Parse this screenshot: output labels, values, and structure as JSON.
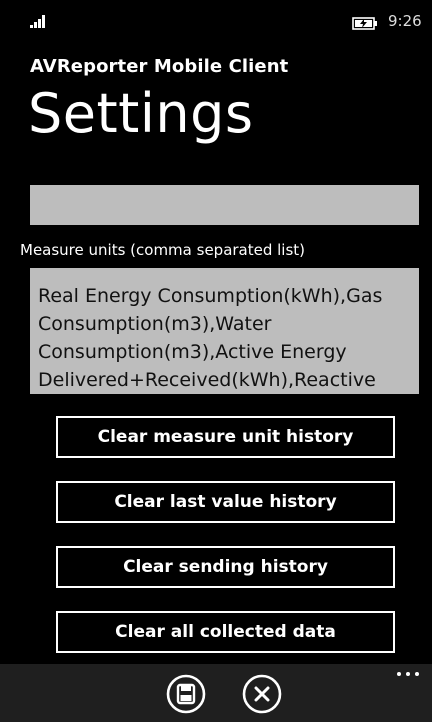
{
  "status_bar": {
    "time": "9:26",
    "signal_icon": "signal-strength-icon",
    "battery_icon": "battery-charging-icon"
  },
  "header": {
    "app_title": "AVReporter Mobile Client",
    "page_title": "Settings"
  },
  "form": {
    "top_field_value": "",
    "units_label": "Measure units (comma separated list)",
    "units_value": "Real Energy Consumption(kWh),Gas Consumption(m3),Water Consumption(m3),Active Energy Delivered+Received(kWh),Reactive Energy Delivered+Received(kVARh)"
  },
  "actions": {
    "clear_measure_unit_history": "Clear measure unit history",
    "clear_last_value_history": "Clear last value history",
    "clear_sending_history": "Clear sending history",
    "clear_all_collected_data": "Clear all collected data"
  },
  "app_bar": {
    "save_icon": "save-icon",
    "cancel_icon": "cancel-icon",
    "more_icon": "more-icon"
  },
  "colors": {
    "background": "#000000",
    "field_bg": "#bdbdbd",
    "app_bar_bg": "#1f1f1f",
    "text": "#ffffff"
  }
}
